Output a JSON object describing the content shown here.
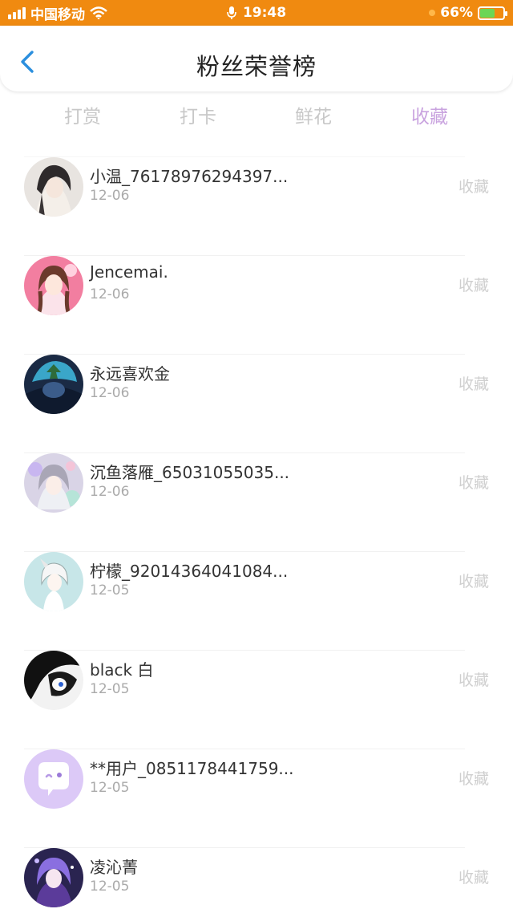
{
  "status_bar": {
    "carrier": "中国移动",
    "time": "19:48",
    "battery": "66%",
    "battery_level": 0.66,
    "icons": [
      "signal-icon",
      "wifi-icon",
      "mic-icon",
      "charging-battery-icon"
    ]
  },
  "header": {
    "title": "粉丝荣誉榜",
    "back_icon": "chevron-left-icon",
    "accent": "#2b8fde"
  },
  "tabs": [
    {
      "label": "打赏",
      "active": false
    },
    {
      "label": "打卡",
      "active": false
    },
    {
      "label": "鲜花",
      "active": false
    },
    {
      "label": "收藏",
      "active": true
    }
  ],
  "colors": {
    "status_bar": "#f08a10",
    "active_tab": "#c9a3df",
    "inactive_tab": "#c8c8c8"
  },
  "fans": [
    {
      "name": "小温_76178976294397...",
      "date": "12-06",
      "action": "收藏"
    },
    {
      "name": "Jencemai.",
      "date": "12-06",
      "action": "收藏"
    },
    {
      "name": "永远喜欢金",
      "date": "12-06",
      "action": "收藏"
    },
    {
      "name": "沉鱼落雁_65031055035...",
      "date": "12-06",
      "action": "收藏"
    },
    {
      "name": "柠檬_92014364041084...",
      "date": "12-05",
      "action": "收藏"
    },
    {
      "name": "black 白",
      "date": "12-05",
      "action": "收藏"
    },
    {
      "name": "**用户_0851178441759...",
      "date": "12-05",
      "action": "收藏"
    },
    {
      "name": "凌沁菁",
      "date": "12-05",
      "action": "收藏"
    }
  ]
}
